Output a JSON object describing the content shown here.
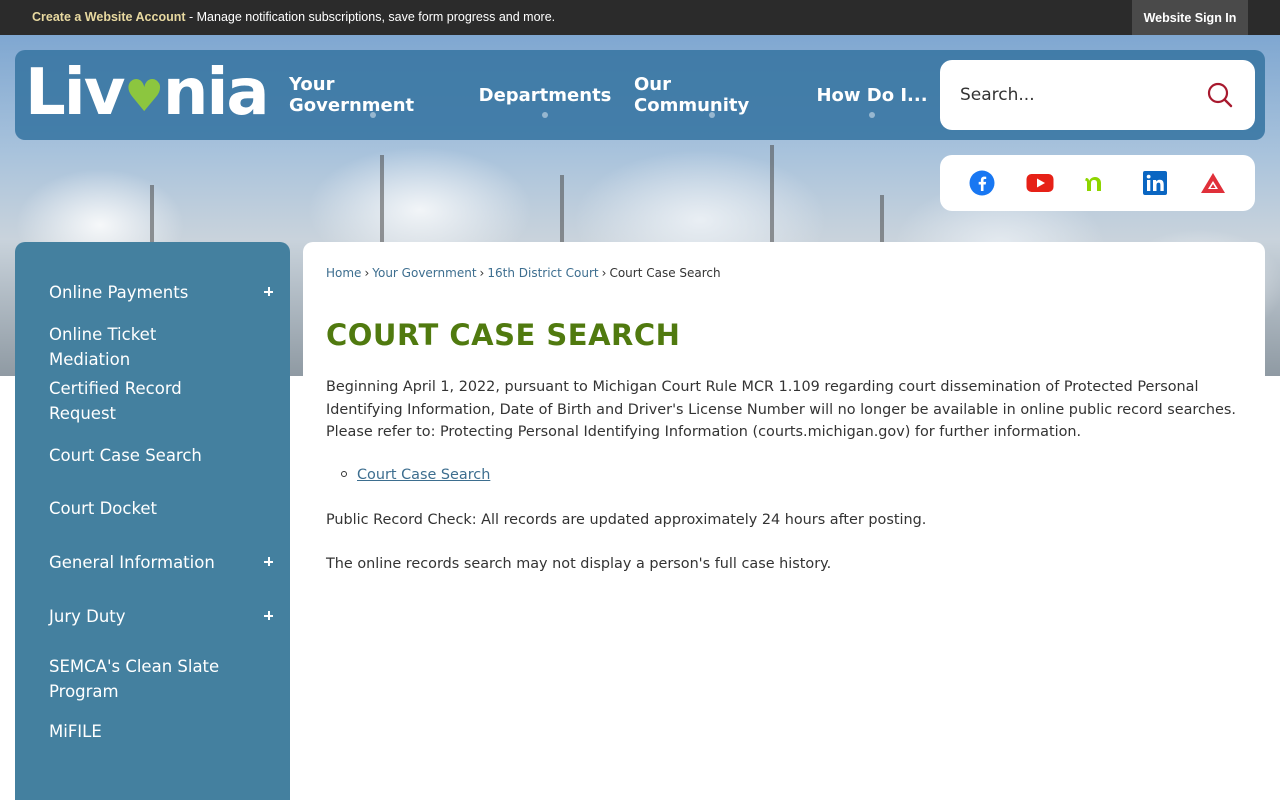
{
  "topbar": {
    "account_link": "Create a Website Account",
    "account_text": " - Manage notification subscriptions, save form progress and more.",
    "sign_in": "Website Sign In"
  },
  "logo": {
    "left": "Liv",
    "heart": "♥",
    "right": "nia"
  },
  "nav": {
    "items": [
      "Your Government",
      "Departments",
      "Our Community",
      "How Do I..."
    ]
  },
  "search": {
    "placeholder": "Search..."
  },
  "social": {
    "icons": [
      "facebook-icon",
      "youtube-icon",
      "nextdoor-icon",
      "linkedin-icon",
      "alert-icon"
    ],
    "colors": {
      "facebook": "#1877f2",
      "youtube": "#e62117",
      "nextdoor": "#8ed500",
      "linkedin": "#0a66c2",
      "alert": "#e0303a"
    }
  },
  "sidebar": {
    "items": [
      {
        "label": "Online Payments",
        "expandable": true
      },
      {
        "label": "Online Ticket Mediation",
        "expandable": false
      },
      {
        "label": "Certified Record Request",
        "expandable": false
      },
      {
        "label": "Court Case Search",
        "expandable": false
      },
      {
        "label": "Court Docket",
        "expandable": false
      },
      {
        "label": "General Information",
        "expandable": true
      },
      {
        "label": "Jury Duty",
        "expandable": true
      },
      {
        "label": "SEMCA's Clean Slate Program",
        "expandable": false
      },
      {
        "label": "MiFILE",
        "expandable": false
      }
    ]
  },
  "breadcrumb": {
    "items": [
      "Home",
      "Your Government",
      "16th District Court"
    ],
    "current": "Court Case Search"
  },
  "main": {
    "title": "COURT CASE SEARCH",
    "paragraph1": "Beginning April 1, 2022, pursuant to Michigan Court Rule MCR 1.109 regarding court dissemination of Protected Personal Identifying Information, Date of Birth and Driver's License Number will no longer be available in online public record searches. Please refer to: Protecting Personal Identifying Information (courts.michigan.gov) for further information.",
    "link": "Court Case Search",
    "paragraph2": "Public Record Check:  All records are updated approximately 24 hours after posting.",
    "paragraph3": "The online records search may not display a person's full case history."
  },
  "colors": {
    "brand_blue": "#3c78a5",
    "sidebar_blue": "#44809f",
    "title_green": "#507a0f",
    "logo_green": "#8cc63f"
  }
}
